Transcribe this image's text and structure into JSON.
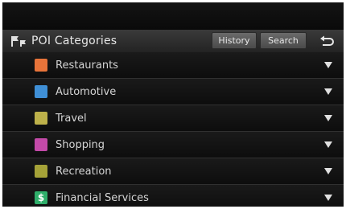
{
  "header": {
    "title": "POI Categories",
    "history_label": "History",
    "search_label": "Search",
    "back_icon": "back-arrow-icon"
  },
  "categories": [
    {
      "label": "Restaurants",
      "icon": "restaurant-icon",
      "color": "#e8743a"
    },
    {
      "label": "Automotive",
      "icon": "car-icon",
      "color": "#3f8fd6"
    },
    {
      "label": "Travel",
      "icon": "luggage-icon",
      "color": "#bdb14a"
    },
    {
      "label": "Shopping",
      "icon": "shopping-bag-icon",
      "color": "#c34aa8"
    },
    {
      "label": "Recreation",
      "icon": "recreation-icon",
      "color": "#a5a238"
    },
    {
      "label": "Financial Services",
      "icon": "dollar-icon",
      "color": "#2fae6a",
      "glyph": "$"
    }
  ]
}
